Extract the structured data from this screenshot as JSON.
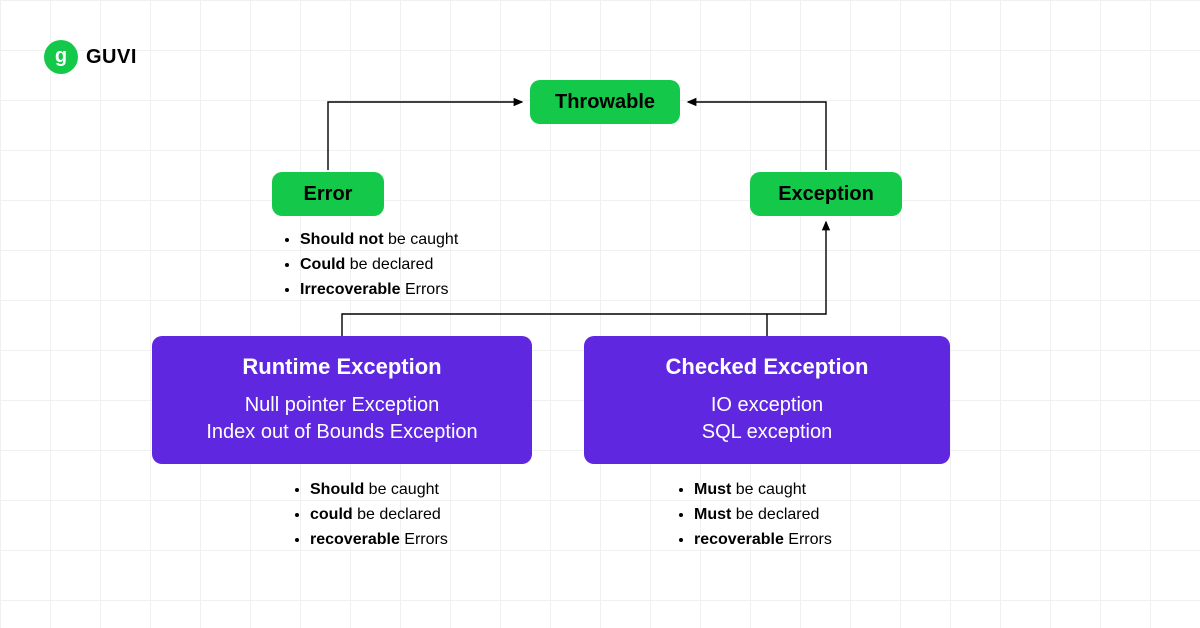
{
  "logo": {
    "text": "GUVI",
    "glyph": "g"
  },
  "nodes": {
    "throwable": "Throwable",
    "error": "Error",
    "exception": "Exception",
    "runtime": {
      "title": "Runtime Exception",
      "line1": "Null pointer Exception",
      "line2": "Index out of Bounds Exception"
    },
    "checked": {
      "title": "Checked Exception",
      "line1": "IO exception",
      "line2": "SQL exception"
    }
  },
  "bullets": {
    "error": [
      {
        "bold": "Should not",
        "rest": " be caught"
      },
      {
        "bold": "Could",
        "rest": " be declared"
      },
      {
        "bold": "Irrecoverable",
        "rest": " Errors"
      }
    ],
    "runtime": [
      {
        "bold": "Should",
        "rest": "  be caught"
      },
      {
        "bold": "could",
        "rest": " be declared"
      },
      {
        "bold": "recoverable",
        "rest": " Errors"
      }
    ],
    "checked": [
      {
        "bold": "Must",
        "rest": "  be caught"
      },
      {
        "bold": "Must",
        "rest": " be declared"
      },
      {
        "bold": "recoverable",
        "rest": " Errors"
      }
    ]
  }
}
